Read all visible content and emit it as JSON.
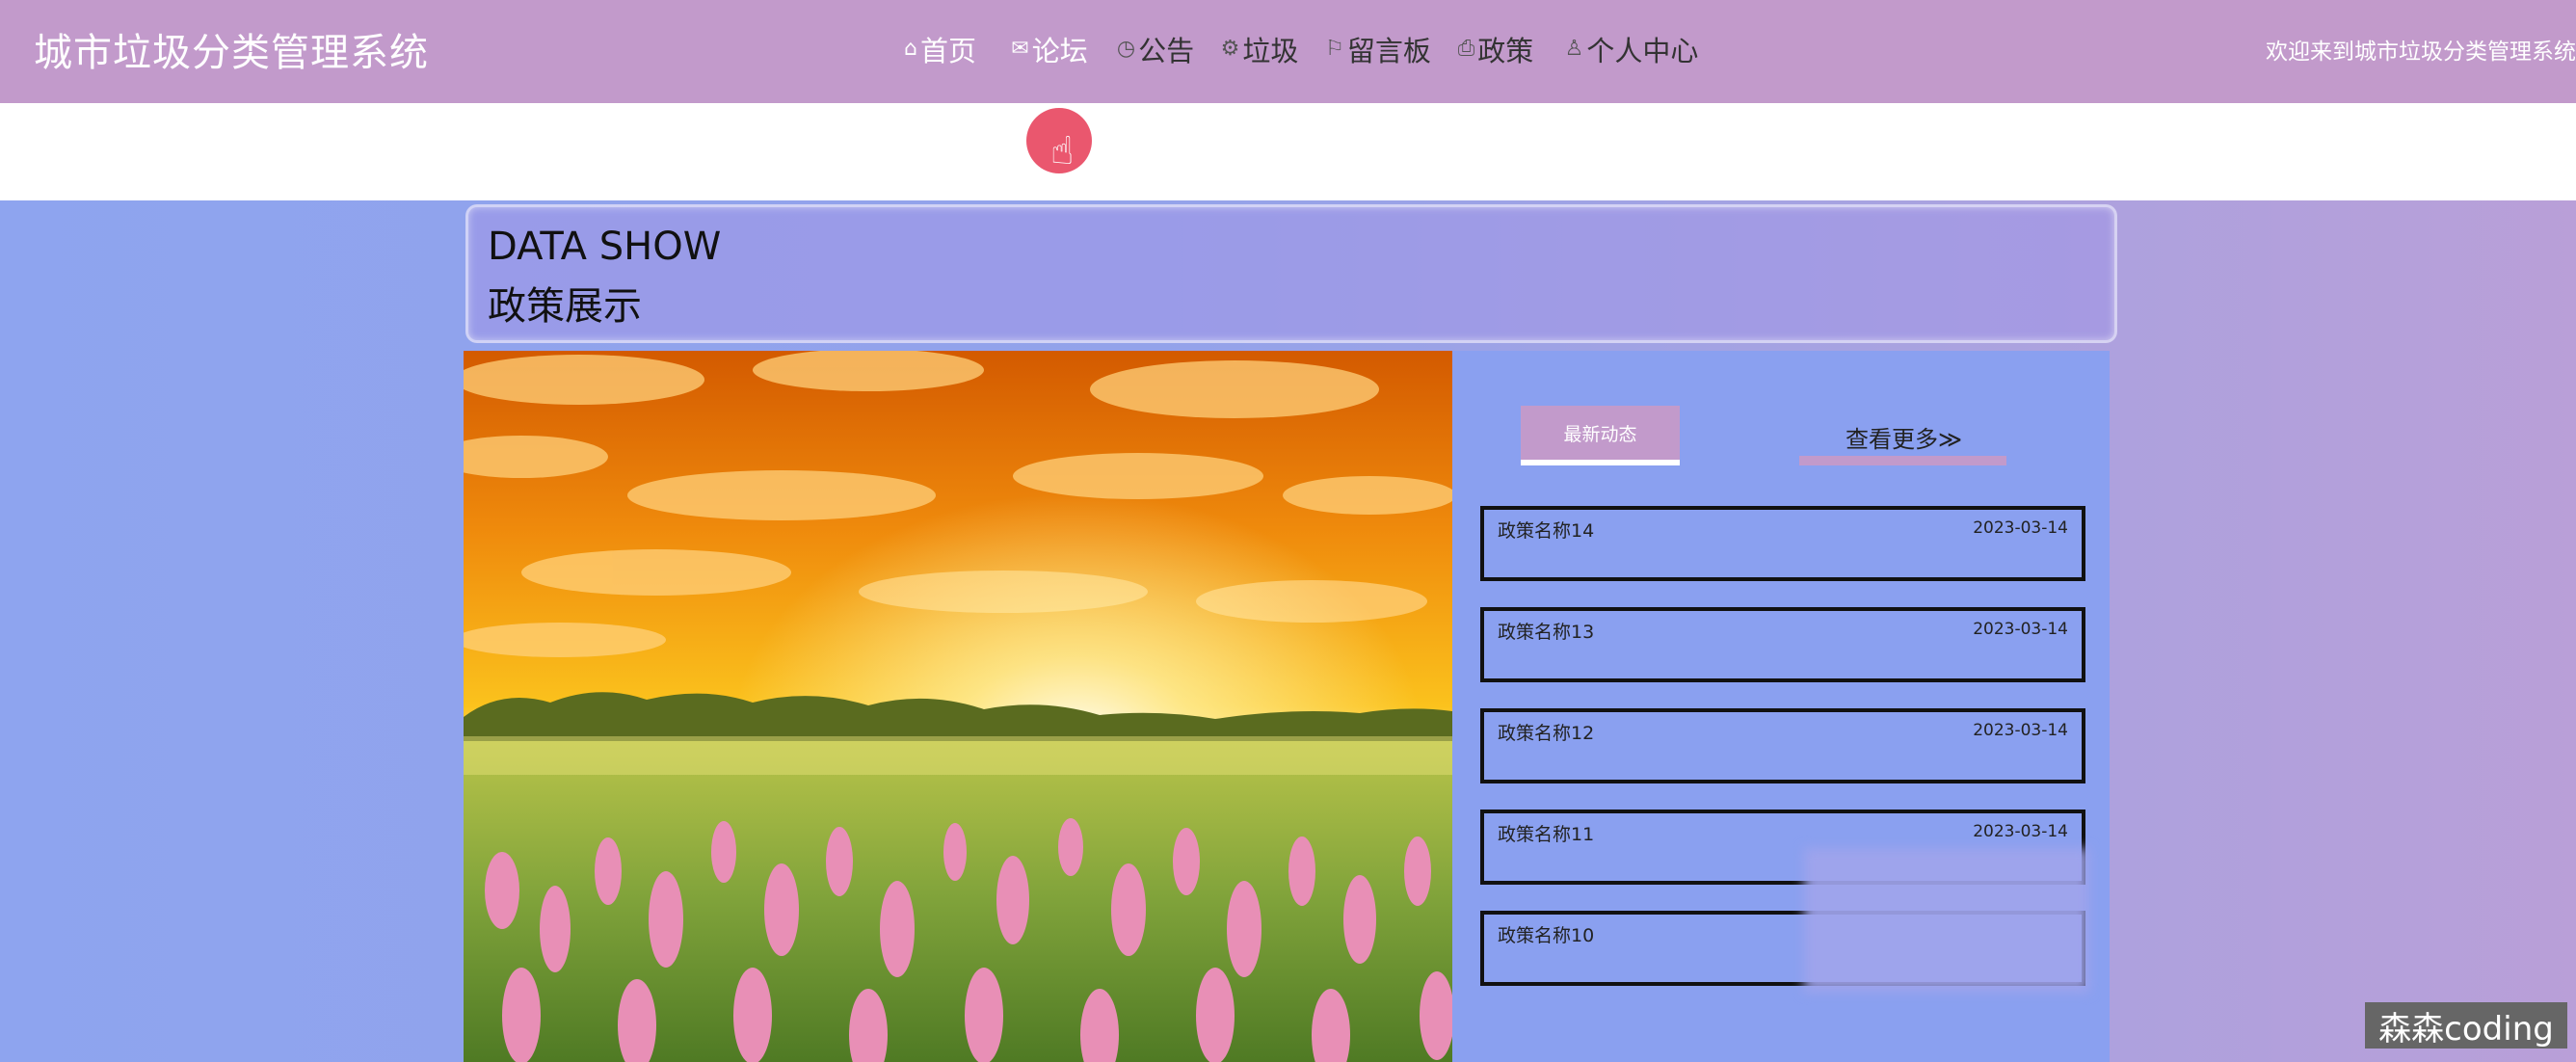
{
  "header": {
    "site_title": "城市垃圾分类管理系统",
    "welcome": "欢迎来到城市垃圾分类管理系统"
  },
  "nav": [
    {
      "icon": "home-icon",
      "glyph": "⌂",
      "label": "首页",
      "active": true
    },
    {
      "icon": "mail-icon",
      "glyph": "✉",
      "label": "论坛",
      "active": true
    },
    {
      "icon": "clock-icon",
      "glyph": "◷",
      "label": "公告",
      "active": false
    },
    {
      "icon": "gear-icon",
      "glyph": "⚙",
      "label": "垃圾",
      "active": false
    },
    {
      "icon": "flag-icon",
      "glyph": "⚐",
      "label": "留言板",
      "active": false
    },
    {
      "icon": "printer-icon",
      "glyph": "⎙",
      "label": "政策",
      "active": false
    },
    {
      "icon": "user-icon",
      "glyph": "♙",
      "label": "个人中心",
      "active": false
    }
  ],
  "section": {
    "title_en": "DATA SHOW",
    "title_cn": "政策展示"
  },
  "image": {
    "description_icon": "sunset-meadow-image"
  },
  "panel": {
    "tab_label": "最新动态",
    "more_label": "查看更多≫"
  },
  "news": [
    {
      "title": "政策名称14",
      "date": "2023-03-14"
    },
    {
      "title": "政策名称13",
      "date": "2023-03-14"
    },
    {
      "title": "政策名称12",
      "date": "2023-03-14"
    },
    {
      "title": "政策名称11",
      "date": "2023-03-14"
    },
    {
      "title": "政策名称10",
      "date": ""
    }
  ],
  "watermark": "森森coding",
  "colors": {
    "accent": "#c29acb",
    "panel": "#8aa0f0"
  }
}
